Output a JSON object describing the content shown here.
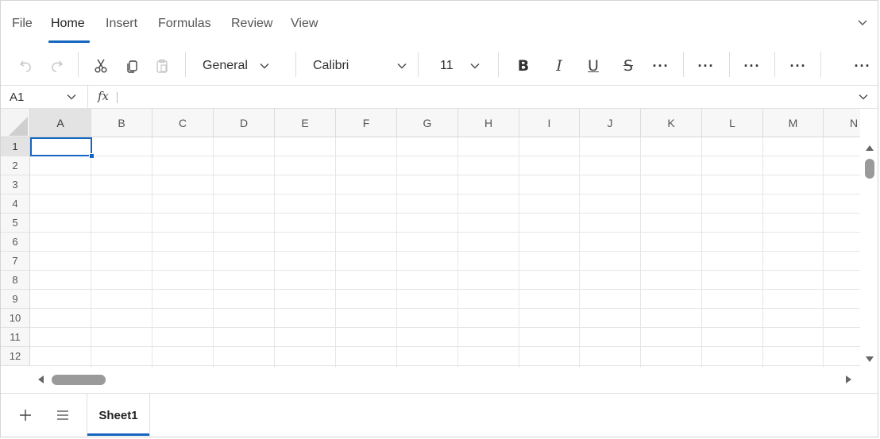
{
  "ribbon": {
    "tabs": [
      "File",
      "Home",
      "Insert",
      "Formulas",
      "Review",
      "View"
    ],
    "active_tab": "Home"
  },
  "toolbar": {
    "number_format": "General",
    "font_name": "Calibri",
    "font_size": "11",
    "bold_glyph": "B",
    "italic_glyph": "I",
    "underline_glyph": "U",
    "strike_glyph": "S",
    "more": "···"
  },
  "formula_bar": {
    "cell_ref": "A1",
    "fx": "fx",
    "formula": ""
  },
  "grid": {
    "columns": [
      "A",
      "B",
      "C",
      "D",
      "E",
      "F",
      "G",
      "H",
      "I",
      "J",
      "K",
      "L",
      "M",
      "N"
    ],
    "rows": [
      "1",
      "2",
      "3",
      "4",
      "5",
      "6",
      "7",
      "8",
      "9",
      "10",
      "11",
      "12"
    ],
    "selected_column": "A",
    "selected_row": "1"
  },
  "sheets": {
    "tabs": [
      "Sheet1"
    ],
    "active": "Sheet1"
  },
  "colors": {
    "accent": "#1565c0",
    "header_bg": "#f7f7f7",
    "selected_header_bg": "#e3e3e3",
    "gridline": "#e6e6e6"
  }
}
